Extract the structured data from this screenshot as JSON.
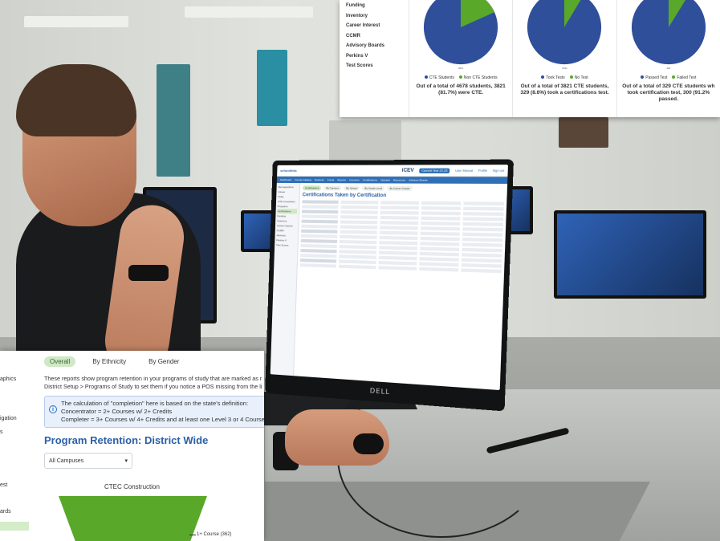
{
  "colors": {
    "cte_blue": "#2f4f9a",
    "cte_green": "#5aa82a",
    "accent_blue": "#2b5fa6",
    "tab_green": "#cfe8c5"
  },
  "dashboard": {
    "sidebar": [
      "Funding",
      "Inventory",
      "Career Interest",
      "CCMR",
      "Advisory Boards",
      "Perkins V",
      "Test Scores"
    ],
    "pies": [
      {
        "caption": "3821",
        "legend": [
          "CTE Students",
          "Non CTE Students"
        ],
        "green_share": 0.183,
        "note": "Out of a total of 4678 students, 3821 (81.7%) were CTE."
      },
      {
        "caption": "3492",
        "legend": [
          "Took Tests",
          "No Test"
        ],
        "green_share": 0.086,
        "note": "Out of a total of 3821 CTE students, 329 (8.6%) took a certifications test."
      },
      {
        "caption": "300",
        "legend": [
          "Passed Test",
          "Failed Test"
        ],
        "green_share": 0.088,
        "note": "Out of a total of 329 CTE students wh took certification test, 300 (91.2% passed."
      }
    ]
  },
  "retention": {
    "sidebar": [
      "aphics",
      "igation",
      "s",
      "est",
      "ards"
    ],
    "tabs": [
      "Overall",
      "By Ethnicity",
      "By Gender"
    ],
    "description_line1": "These reports show program retention in your programs of study that are marked as r",
    "description_line2": "District Setup > Programs of Study to set them if you notice a POS missing from the li",
    "info_line1": "The calculation of \"completion\" here is based on the state's definition:",
    "info_line2": "Concentrator = 2+ Courses w/ 2+ Credits",
    "info_line3": "Completer = 3+ Courses w/ 4+ Credits and at least one Level 3 or 4 Course",
    "title": "Program Retention: District Wide",
    "campus_select": "All Campuses",
    "chart_title": "CTEC Construction",
    "funnel_label": "1+ Course (362)"
  },
  "monitor": {
    "brand": "DELL",
    "logo": "schoolinks",
    "cev": "iCEV",
    "pill": "Current Year 22-23",
    "links": [
      "User Manual",
      "Profile",
      "Sign out"
    ],
    "nav": [
      "Dashboard",
      "Course Catalog",
      "Students",
      "Funds",
      "Reports",
      "Inventory",
      "Certifications",
      "Uploads",
      "Resources",
      "Advisory Boards"
    ],
    "side": [
      "Demographics",
      "Career",
      "Clubs",
      "CTE Completers",
      "Programs",
      "Certifications",
      "Funding",
      "Inventory",
      "Career Interest",
      "CCMR",
      "Advisory",
      "Perkins V",
      "Test Scores"
    ],
    "tabs": [
      "Certifications",
      "By Campus",
      "By School",
      "By Grade Level",
      "By Career Cluster"
    ],
    "title": "Certifications Taken by Certification"
  }
}
